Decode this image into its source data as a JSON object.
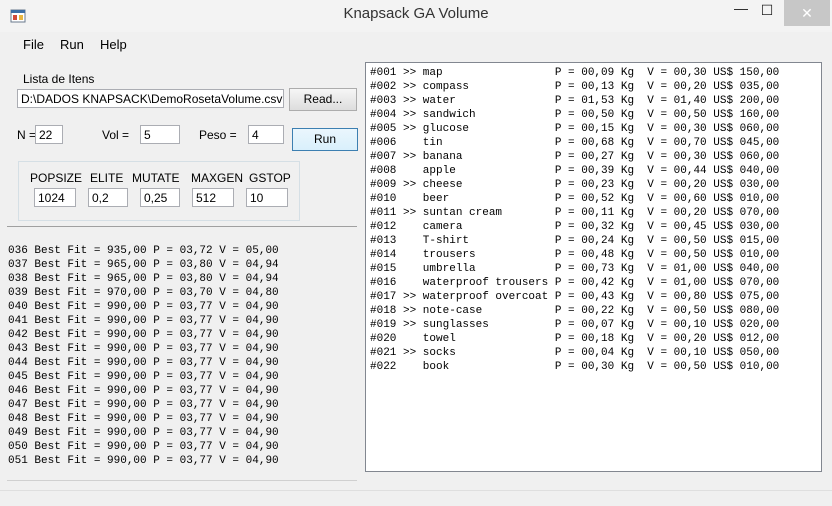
{
  "window": {
    "title": "Knapsack GA Volume",
    "minimize_glyph": "—",
    "maximize_glyph": "☐",
    "close_glyph": "✕"
  },
  "menu": [
    "File",
    "Run",
    "Help"
  ],
  "items_file": {
    "label": "Lista de Itens",
    "path": "D:\\DADOS KNAPSACK\\DemoRosetaVolume.csv",
    "read_label": "Read..."
  },
  "params": {
    "n_label": "N =",
    "n_value": "22",
    "vol_label": "Vol =",
    "vol_value": "5",
    "peso_label": "Peso =",
    "peso_value": "4",
    "run_label": "Run"
  },
  "ga": {
    "headers": [
      "POPSIZE",
      "ELITE",
      "MUTATE",
      "MAXGEN",
      "GSTOP"
    ],
    "values": [
      "1024",
      "0,2",
      "0,25",
      "512",
      "10"
    ]
  },
  "log_lines": [
    "036 Best Fit = 935,00 P = 03,72 V = 05,00",
    "037 Best Fit = 965,00 P = 03,80 V = 04,94",
    "038 Best Fit = 965,00 P = 03,80 V = 04,94",
    "039 Best Fit = 970,00 P = 03,70 V = 04,80",
    "040 Best Fit = 990,00 P = 03,77 V = 04,90",
    "041 Best Fit = 990,00 P = 03,77 V = 04,90",
    "042 Best Fit = 990,00 P = 03,77 V = 04,90",
    "043 Best Fit = 990,00 P = 03,77 V = 04,90",
    "044 Best Fit = 990,00 P = 03,77 V = 04,90",
    "045 Best Fit = 990,00 P = 03,77 V = 04,90",
    "046 Best Fit = 990,00 P = 03,77 V = 04,90",
    "047 Best Fit = 990,00 P = 03,77 V = 04,90",
    "048 Best Fit = 990,00 P = 03,77 V = 04,90",
    "049 Best Fit = 990,00 P = 03,77 V = 04,90",
    "050 Best Fit = 990,00 P = 03,77 V = 04,90",
    "051 Best Fit = 990,00 P = 03,77 V = 04,90"
  ],
  "item_lines": [
    "#001 >> map                 P = 00,09 Kg  V = 00,30 US$ 150,00",
    "#002 >> compass             P = 00,13 Kg  V = 00,20 US$ 035,00",
    "#003 >> water               P = 01,53 Kg  V = 01,40 US$ 200,00",
    "#004 >> sandwich            P = 00,50 Kg  V = 00,50 US$ 160,00",
    "#005 >> glucose             P = 00,15 Kg  V = 00,30 US$ 060,00",
    "#006    tin                 P = 00,68 Kg  V = 00,70 US$ 045,00",
    "#007 >> banana              P = 00,27 Kg  V = 00,30 US$ 060,00",
    "#008    apple               P = 00,39 Kg  V = 00,44 US$ 040,00",
    "#009 >> cheese              P = 00,23 Kg  V = 00,20 US$ 030,00",
    "#010    beer                P = 00,52 Kg  V = 00,60 US$ 010,00",
    "#011 >> suntan cream        P = 00,11 Kg  V = 00,20 US$ 070,00",
    "#012    camera              P = 00,32 Kg  V = 00,45 US$ 030,00",
    "#013    T-shirt             P = 00,24 Kg  V = 00,50 US$ 015,00",
    "#014    trousers            P = 00,48 Kg  V = 00,50 US$ 010,00",
    "#015    umbrella            P = 00,73 Kg  V = 01,00 US$ 040,00",
    "#016    waterproof trousers P = 00,42 Kg  V = 01,00 US$ 070,00",
    "#017 >> waterproof overcoat P = 00,43 Kg  V = 00,80 US$ 075,00",
    "#018 >> note-case           P = 00,22 Kg  V = 00,50 US$ 080,00",
    "#019 >> sunglasses          P = 00,07 Kg  V = 00,10 US$ 020,00",
    "#020    towel               P = 00,18 Kg  V = 00,20 US$ 012,00",
    "#021 >> socks               P = 00,04 Kg  V = 00,10 US$ 050,00",
    "#022    book                P = 00,30 Kg  V = 00,50 US$ 010,00"
  ]
}
